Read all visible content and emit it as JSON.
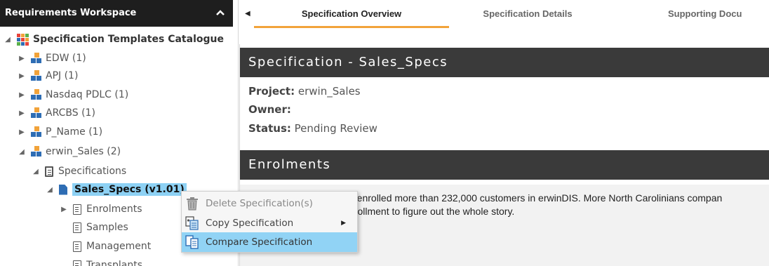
{
  "left_panel": {
    "title": "Requirements Workspace",
    "collapse_icon": "chevron-up-icon",
    "tree": {
      "root": {
        "label": "Specification Templates Catalogue",
        "icon": "grid-catalog-icon"
      },
      "projects": [
        {
          "label": "EDW (1)"
        },
        {
          "label": "APJ (1)"
        },
        {
          "label": "Nasdaq PDLC (1)"
        },
        {
          "label": "ARCBS (1)"
        },
        {
          "label": "P_Name (1)"
        },
        {
          "label": "erwin_Sales (2)"
        }
      ],
      "specifications_folder": "Specifications",
      "selected_spec": "Sales_Specs (v1.01)",
      "sections": [
        "Enrolments",
        "Samples",
        "Management",
        "Transplants"
      ]
    }
  },
  "tabs": [
    {
      "label": "Specification Overview",
      "active": true
    },
    {
      "label": "Specification Details",
      "active": false
    },
    {
      "label": "Supporting Docu",
      "active": false
    }
  ],
  "main": {
    "spec_header": "Specification - Sales_Specs",
    "fields": [
      {
        "label": "Project:",
        "value": "erwin_Sales"
      },
      {
        "label": "Owner:",
        "value": ""
      },
      {
        "label": "Status:",
        "value": "Pending Review"
      }
    ],
    "enrolments_header": "Enrolments",
    "enrolments_text": [
      "e enrolled more than 232,000 customers in erwinDIS. More North Carolinians compan",
      "nrollment to figure out the whole story."
    ]
  },
  "context_menu": {
    "items": [
      {
        "label": "Delete Specification(s)",
        "icon": "trash-icon",
        "disabled": true
      },
      {
        "label": "Copy Specification",
        "icon": "copy-icon",
        "has_submenu": true
      },
      {
        "label": "Compare Specification",
        "icon": "compare-icon",
        "hovered": true
      }
    ]
  },
  "colors": {
    "header_dark": "#1e1e1e",
    "section_dark": "#3a3a3a",
    "active_tab_underline": "#f2a33a",
    "selection_blue": "#8dd1f4",
    "menu_hover": "#91d3f5",
    "project_orange": "#f2a33a",
    "project_blue": "#2e6db4"
  }
}
